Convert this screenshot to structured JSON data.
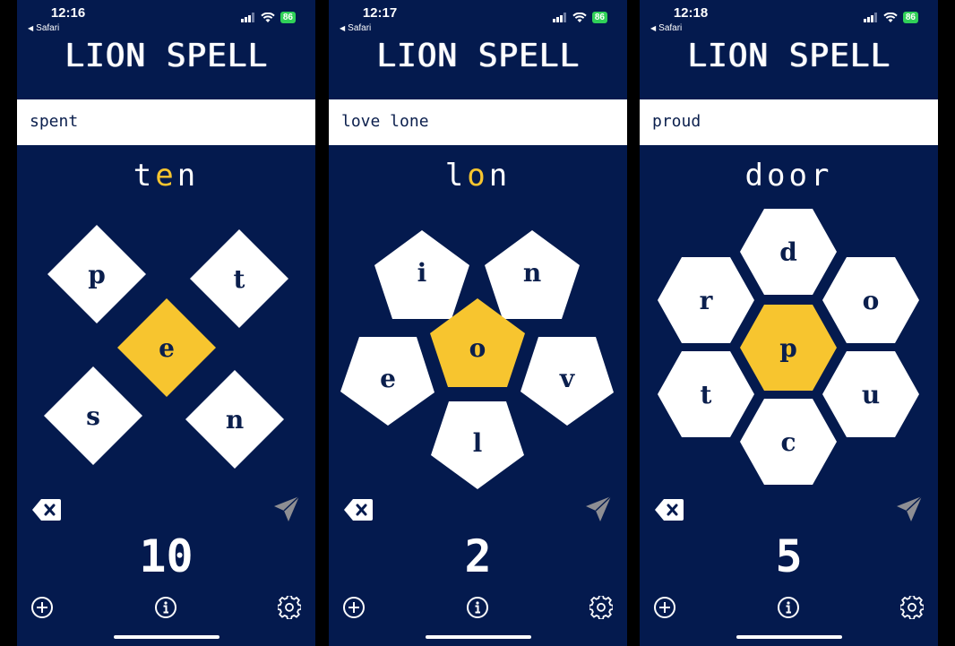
{
  "app_title": "LION SPELL",
  "phones": [
    {
      "status_time": "12:16",
      "back_label": "Safari",
      "battery": "86",
      "found_words": "spent",
      "current_word": {
        "prefix": "t",
        "highlight": "e",
        "suffix": "n"
      },
      "center_letter": "e",
      "outer_letters": [
        "p",
        "t",
        "s",
        "n"
      ],
      "score": "10"
    },
    {
      "status_time": "12:17",
      "back_label": "Safari",
      "battery": "86",
      "found_words": "love lone",
      "current_word": {
        "prefix": "l",
        "highlight": "o",
        "suffix": "n"
      },
      "center_letter": "o",
      "outer_letters": [
        "i",
        "n",
        "e",
        "v",
        "l"
      ],
      "score": "2"
    },
    {
      "status_time": "12:18",
      "back_label": "Safari",
      "battery": "86",
      "found_words": "proud",
      "current_word": {
        "prefix": "door",
        "highlight": "",
        "suffix": ""
      },
      "center_letter": "p",
      "outer_letters": [
        "d",
        "r",
        "o",
        "t",
        "u",
        "c"
      ],
      "score": "5"
    }
  ],
  "colors": {
    "background": "#041a4e",
    "tile": "#ffffff",
    "center_tile": "#f7c52f",
    "letter": "#0b1f4d",
    "submit_icon": "#8e8e93"
  },
  "icons": {
    "delete": "backspace-icon",
    "submit": "paper-plane-icon",
    "new_game": "plus-circle-icon",
    "info": "info-circle-icon",
    "settings": "gear-icon"
  }
}
